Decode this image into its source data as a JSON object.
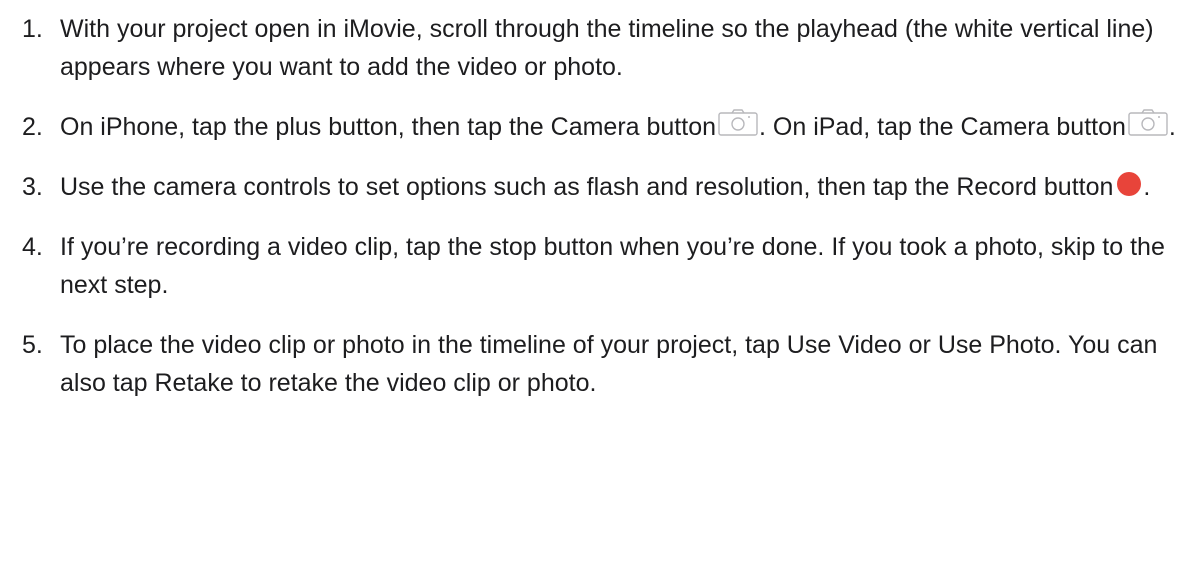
{
  "steps": [
    {
      "number": "1.",
      "text": "With your project open in iMovie, scroll through the timeline so the playhead (the white vertical line) appears where you want to add the video or photo."
    },
    {
      "number": "2.",
      "text_a": "On iPhone, tap the plus button, then tap the Camera button",
      "text_b": ". On iPad, tap the Camera button",
      "text_c": ".",
      "icon": "camera-icon"
    },
    {
      "number": "3.",
      "text_a": "Use the camera controls to set options such as flash and resolution, then tap the Record button",
      "text_b": ".",
      "icon": "record-icon",
      "icon_color": "#e8443a"
    },
    {
      "number": "4.",
      "text": "If you’re recording a video clip, tap the stop button when you’re done. If you took a photo, skip to the next step."
    },
    {
      "number": "5.",
      "text": "To place the video clip or photo in the timeline of your project, tap Use Video or Use Photo. You can also tap Retake to retake the video clip or photo."
    }
  ]
}
